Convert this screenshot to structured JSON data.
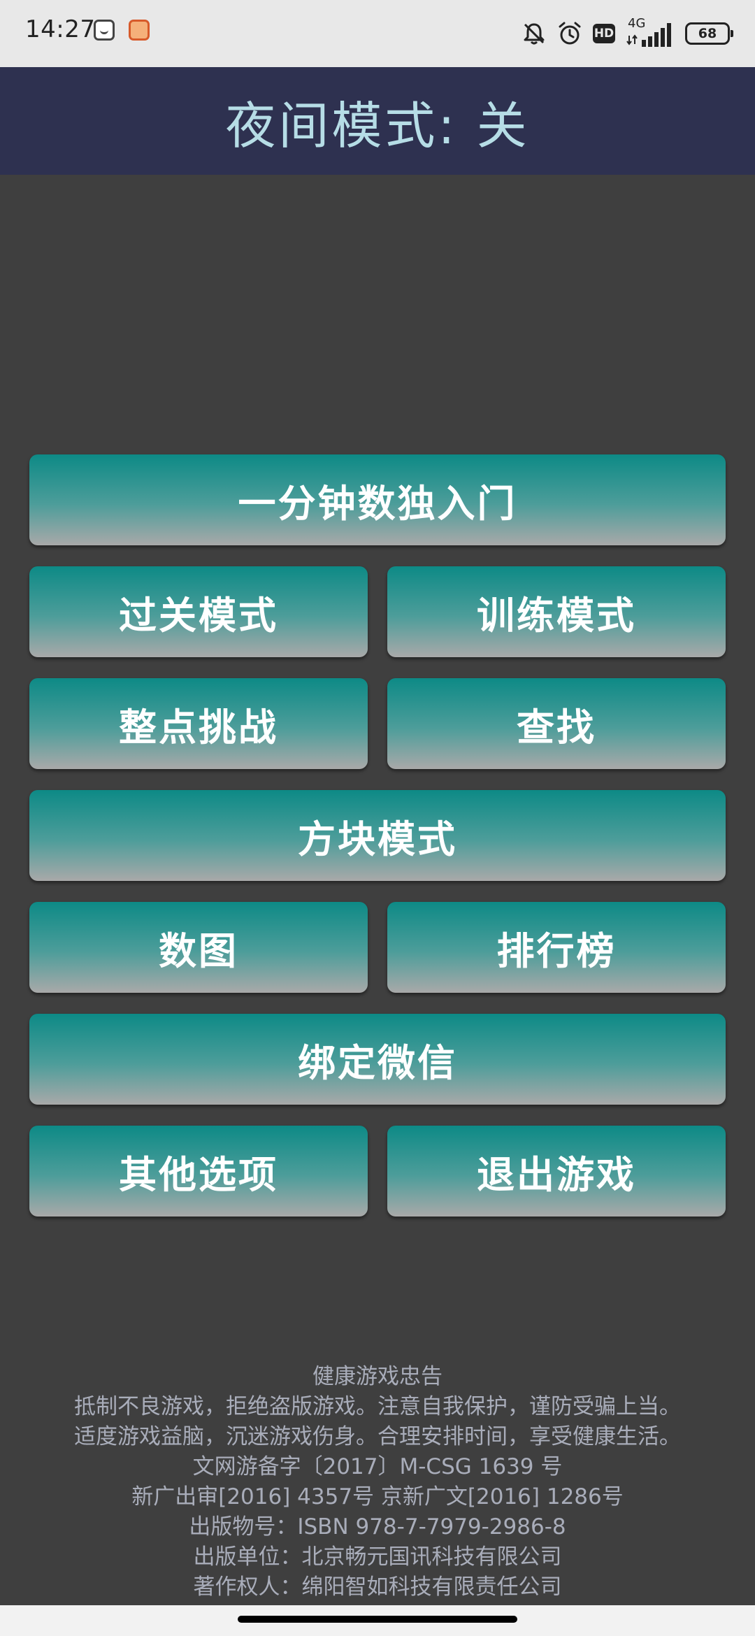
{
  "status_bar": {
    "time": "14:27",
    "network_type": "4G",
    "hd_label": "HD",
    "battery_level": "68",
    "icons": [
      "app-notification-icon-1",
      "app-notification-icon-2",
      "mute-bell-icon",
      "alarm-icon",
      "hd-icon",
      "signal-icon",
      "battery-icon"
    ]
  },
  "header": {
    "title": "夜间模式: 关"
  },
  "menu": {
    "intro": "一分钟数独入门",
    "level_mode": "过关模式",
    "training_mode": "训练模式",
    "hourly_challenge": "整点挑战",
    "search": "查找",
    "block_mode": "方块模式",
    "number_graph": "数图",
    "leaderboard": "排行榜",
    "bind_wechat": "绑定微信",
    "other_options": "其他选项",
    "exit_game": "退出游戏"
  },
  "notice": {
    "line1": "健康游戏忠告",
    "line2": "抵制不良游戏，拒绝盗版游戏。注意自我保护，谨防受骗上当。",
    "line3": "适度游戏益脑，沉迷游戏伤身。合理安排时间，享受健康生活。",
    "line4": "文网游备字〔2017〕M-CSG 1639 号",
    "line5": "新广出审[2016] 4357号 京新广文[2016] 1286号",
    "line6": "出版物号：ISBN 978-7-7979-2986-8",
    "line7": "出版单位：北京畅元国讯科技有限公司",
    "line8": "著作权人：绵阳智如科技有限责任公司"
  },
  "colors": {
    "status_bar_bg": "#e8e8e8",
    "header_bg": "#2e3150",
    "header_text": "#b6dde6",
    "page_bg": "#3f3f3f",
    "button_top": "#0d8a86",
    "button_bottom": "#a9a9a9",
    "button_text": "#ffffff",
    "notice_text": "#a9adba"
  }
}
